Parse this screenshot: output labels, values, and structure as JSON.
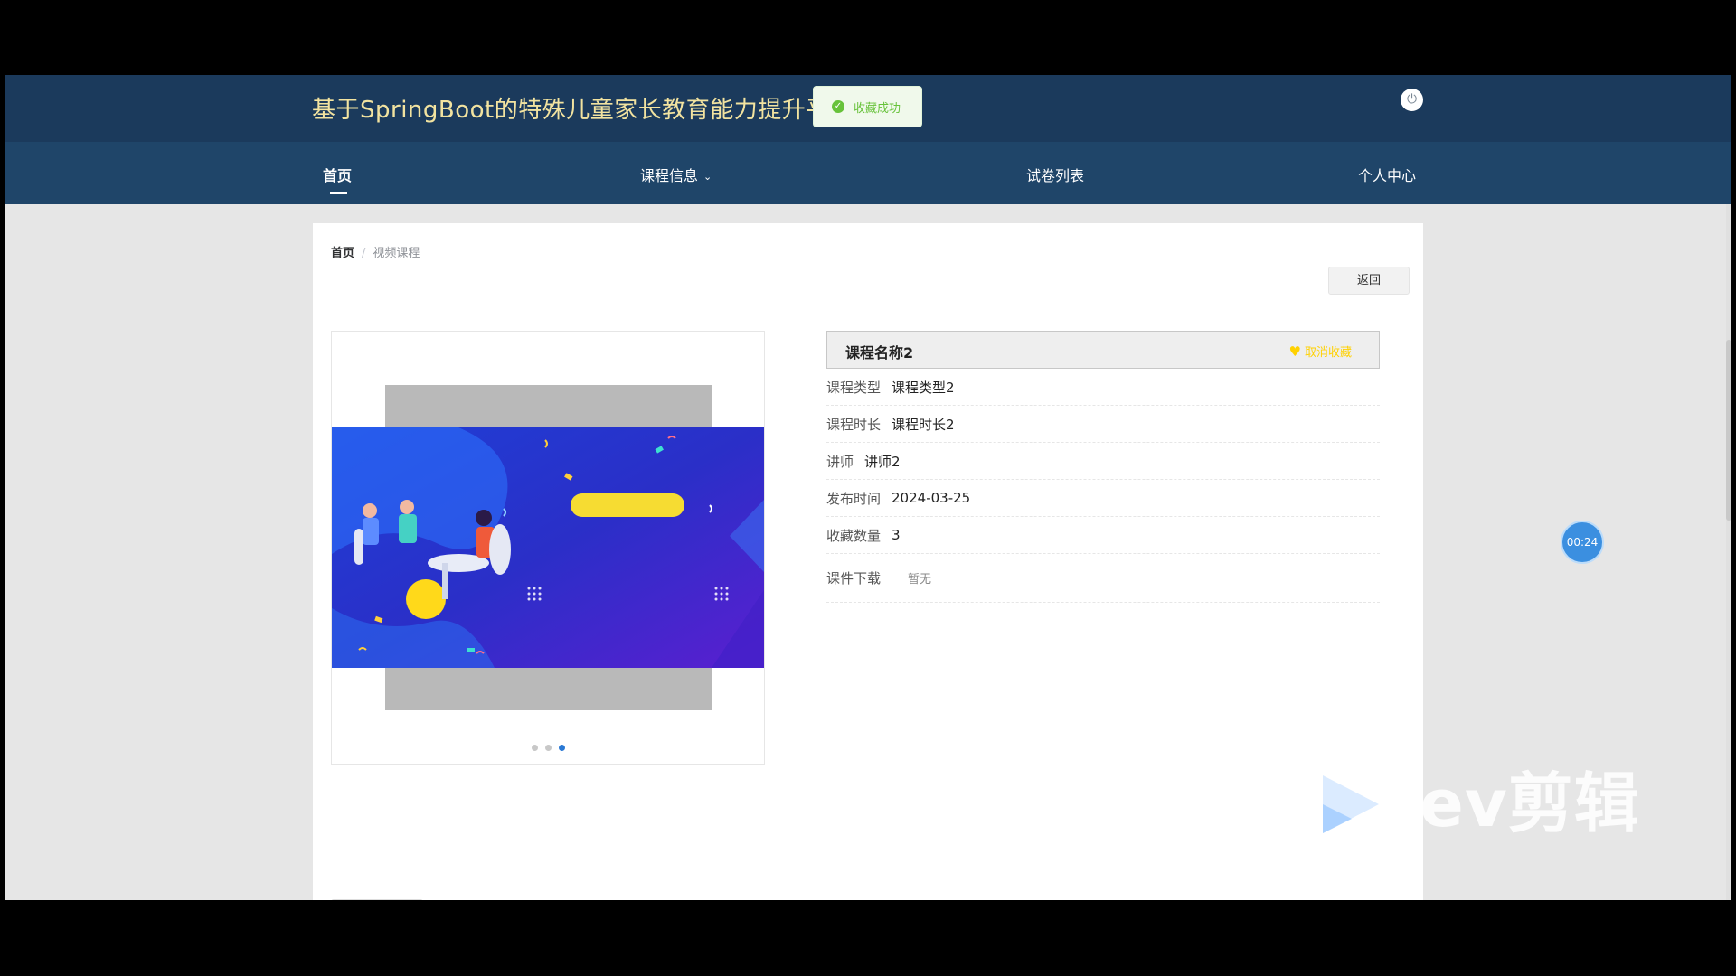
{
  "header": {
    "site_title": "基于SpringBoot的特殊儿童家长教育能力提升平台",
    "power_icon": "power-icon"
  },
  "toast": {
    "text": "收藏成功",
    "icon": "check-circle-icon",
    "color": "#67c23a"
  },
  "nav": {
    "items": [
      {
        "label": "首页",
        "active": true
      },
      {
        "label": "课程信息",
        "has_dropdown": true
      },
      {
        "label": "试卷列表"
      },
      {
        "label": "个人中心"
      }
    ]
  },
  "breadcrumb": {
    "home": "首页",
    "separator": "/",
    "current": "视频课程"
  },
  "back_button": "返回",
  "carousel": {
    "total_slides": 3,
    "active_index": 2
  },
  "course": {
    "name": "课程名称2",
    "favorite_label": "取消收藏",
    "fields": [
      {
        "label": "课程类型",
        "value": "课程类型2"
      },
      {
        "label": "课程时长",
        "value": "课程时长2"
      },
      {
        "label": "讲师",
        "value": "讲师2"
      },
      {
        "label": "发布时间",
        "value": "2024-03-25"
      },
      {
        "label": "收藏数量",
        "value": "3"
      },
      {
        "label": "课件下载",
        "value": "暂无"
      }
    ]
  },
  "timer": "00:24",
  "watermark": "ev剪辑",
  "colors": {
    "topbar": "#1b3a5c",
    "navbar": "#1f4569",
    "title": "#f2e3a0",
    "accent": "#2a79d4",
    "favorite": "#ffd100"
  }
}
